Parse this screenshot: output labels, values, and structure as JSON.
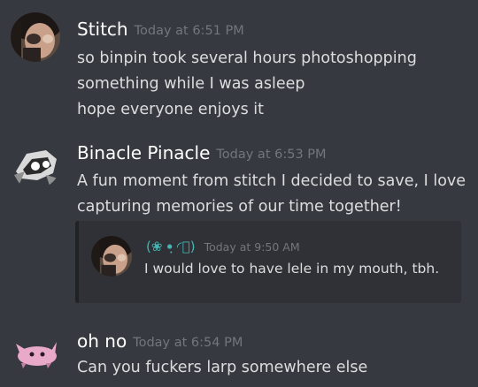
{
  "messages": [
    {
      "author": "Stitch",
      "timestamp": "Today at 6:51 PM",
      "lines": [
        "so binpin took several hours photoshopping",
        "something while I was asleep",
        "hope everyone enjoys it"
      ]
    },
    {
      "author": "Binacle Pinacle",
      "timestamp": "Today at 6:53 PM",
      "lines": [
        "A fun moment from stitch I decided to save, I love",
        "capturing memories of our time together!"
      ],
      "quote": {
        "author": "(❀ •ฺ ◜ฺ)",
        "timestamp": "Today at 9:50 AM",
        "text": "I would love to have lele in my mouth, tbh."
      }
    },
    {
      "author": "oh no",
      "timestamp": "Today at 6:54 PM",
      "lines": [
        "Can you fuckers larp somewhere else"
      ]
    }
  ],
  "colors": {
    "background": "#36393f",
    "text": "#dcddde",
    "author": "#ffffff",
    "timestamp": "#72767d",
    "quote_background": "#2f3136",
    "quote_author": "#43b5b5"
  },
  "icons": {
    "stitch_avatar": "dark-haired-selfie-avatar-icon",
    "binacle_avatar": "skull-mask-avatar-icon",
    "ohno_avatar": "pink-creature-avatar-icon",
    "quote_avatar": "dark-haired-selfie-avatar-icon"
  }
}
